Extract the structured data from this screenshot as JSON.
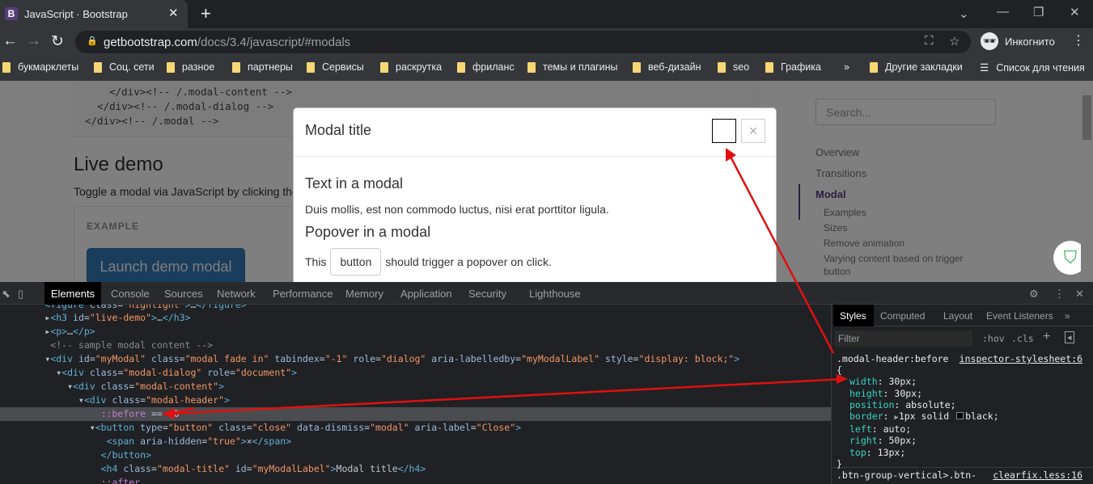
{
  "browser": {
    "tab_title": "JavaScript · Bootstrap",
    "tab_favicon": "B",
    "url_host": "getbootstrap.com",
    "url_path": "/docs/3.4/javascript/#modals",
    "profile": "Инкогнито"
  },
  "bookmarks": [
    "букмарклеты",
    "Соц. сети",
    "разное",
    "партнеры",
    "Сервисы",
    "раскрутка",
    "фриланс",
    "темы и плагины",
    "веб-дизайн",
    "seo",
    "Графика"
  ],
  "bookmarks_overflow": "»",
  "other_bookmarks": "Другие закладки",
  "reading_list": "Список для чтения",
  "page": {
    "code_lines": [
      "    </div><!-- /.modal-content -->",
      "  </div><!-- /.modal-dialog -->",
      "</div><!-- /.modal -->"
    ],
    "live_demo": "Live demo",
    "toggle_text": "Toggle a modal via JavaScript by clicking the",
    "example_label": "EXAMPLE",
    "launch_button": "Launch demo modal",
    "search_placeholder": "Search...",
    "sidebar": [
      {
        "label": "Overview"
      },
      {
        "label": "Transitions"
      },
      {
        "label": "Modal",
        "active": true
      }
    ],
    "sidebar_sub": [
      "Examples",
      "Sizes",
      "Remove animation",
      "Varying content based on trigger",
      "button"
    ]
  },
  "modal": {
    "title": "Modal title",
    "close": "×",
    "heading1": "Text in a modal",
    "text1": "Duis mollis, est non commodo luctus, nisi erat porttitor ligula.",
    "heading2": "Popover in a modal",
    "text2_pre": "This",
    "button": "button",
    "text2_post": "should trigger a popover on click."
  },
  "devtools": {
    "tabs": [
      "Elements",
      "Console",
      "Sources",
      "Network",
      "Performance",
      "Memory",
      "Application",
      "Security",
      "Lighthouse"
    ],
    "styles_tabs": [
      "Styles",
      "Computed",
      "Layout",
      "Event Listeners",
      "»"
    ],
    "filter_placeholder": "Filter",
    "hov": ":hov",
    "cls": ".cls",
    "rule_selector": ".modal-header:before",
    "rule_source": "inspector-stylesheet:6",
    "props": [
      {
        "name": "width",
        "value": "30px;"
      },
      {
        "name": "height",
        "value": "30px;"
      },
      {
        "name": "position",
        "value": "absolute;"
      },
      {
        "name": "border",
        "value": "1px solid",
        "color": "#000000",
        "extra": "black;"
      },
      {
        "name": "left",
        "value": "auto;"
      },
      {
        "name": "right",
        "value": "50px;"
      },
      {
        "name": "top",
        "value": "13px;"
      }
    ],
    "rule2_selector": ".btn-group-vertical>.btn-",
    "rule2_source": "clearfix.less:16"
  },
  "annotation_color": "#e01010"
}
